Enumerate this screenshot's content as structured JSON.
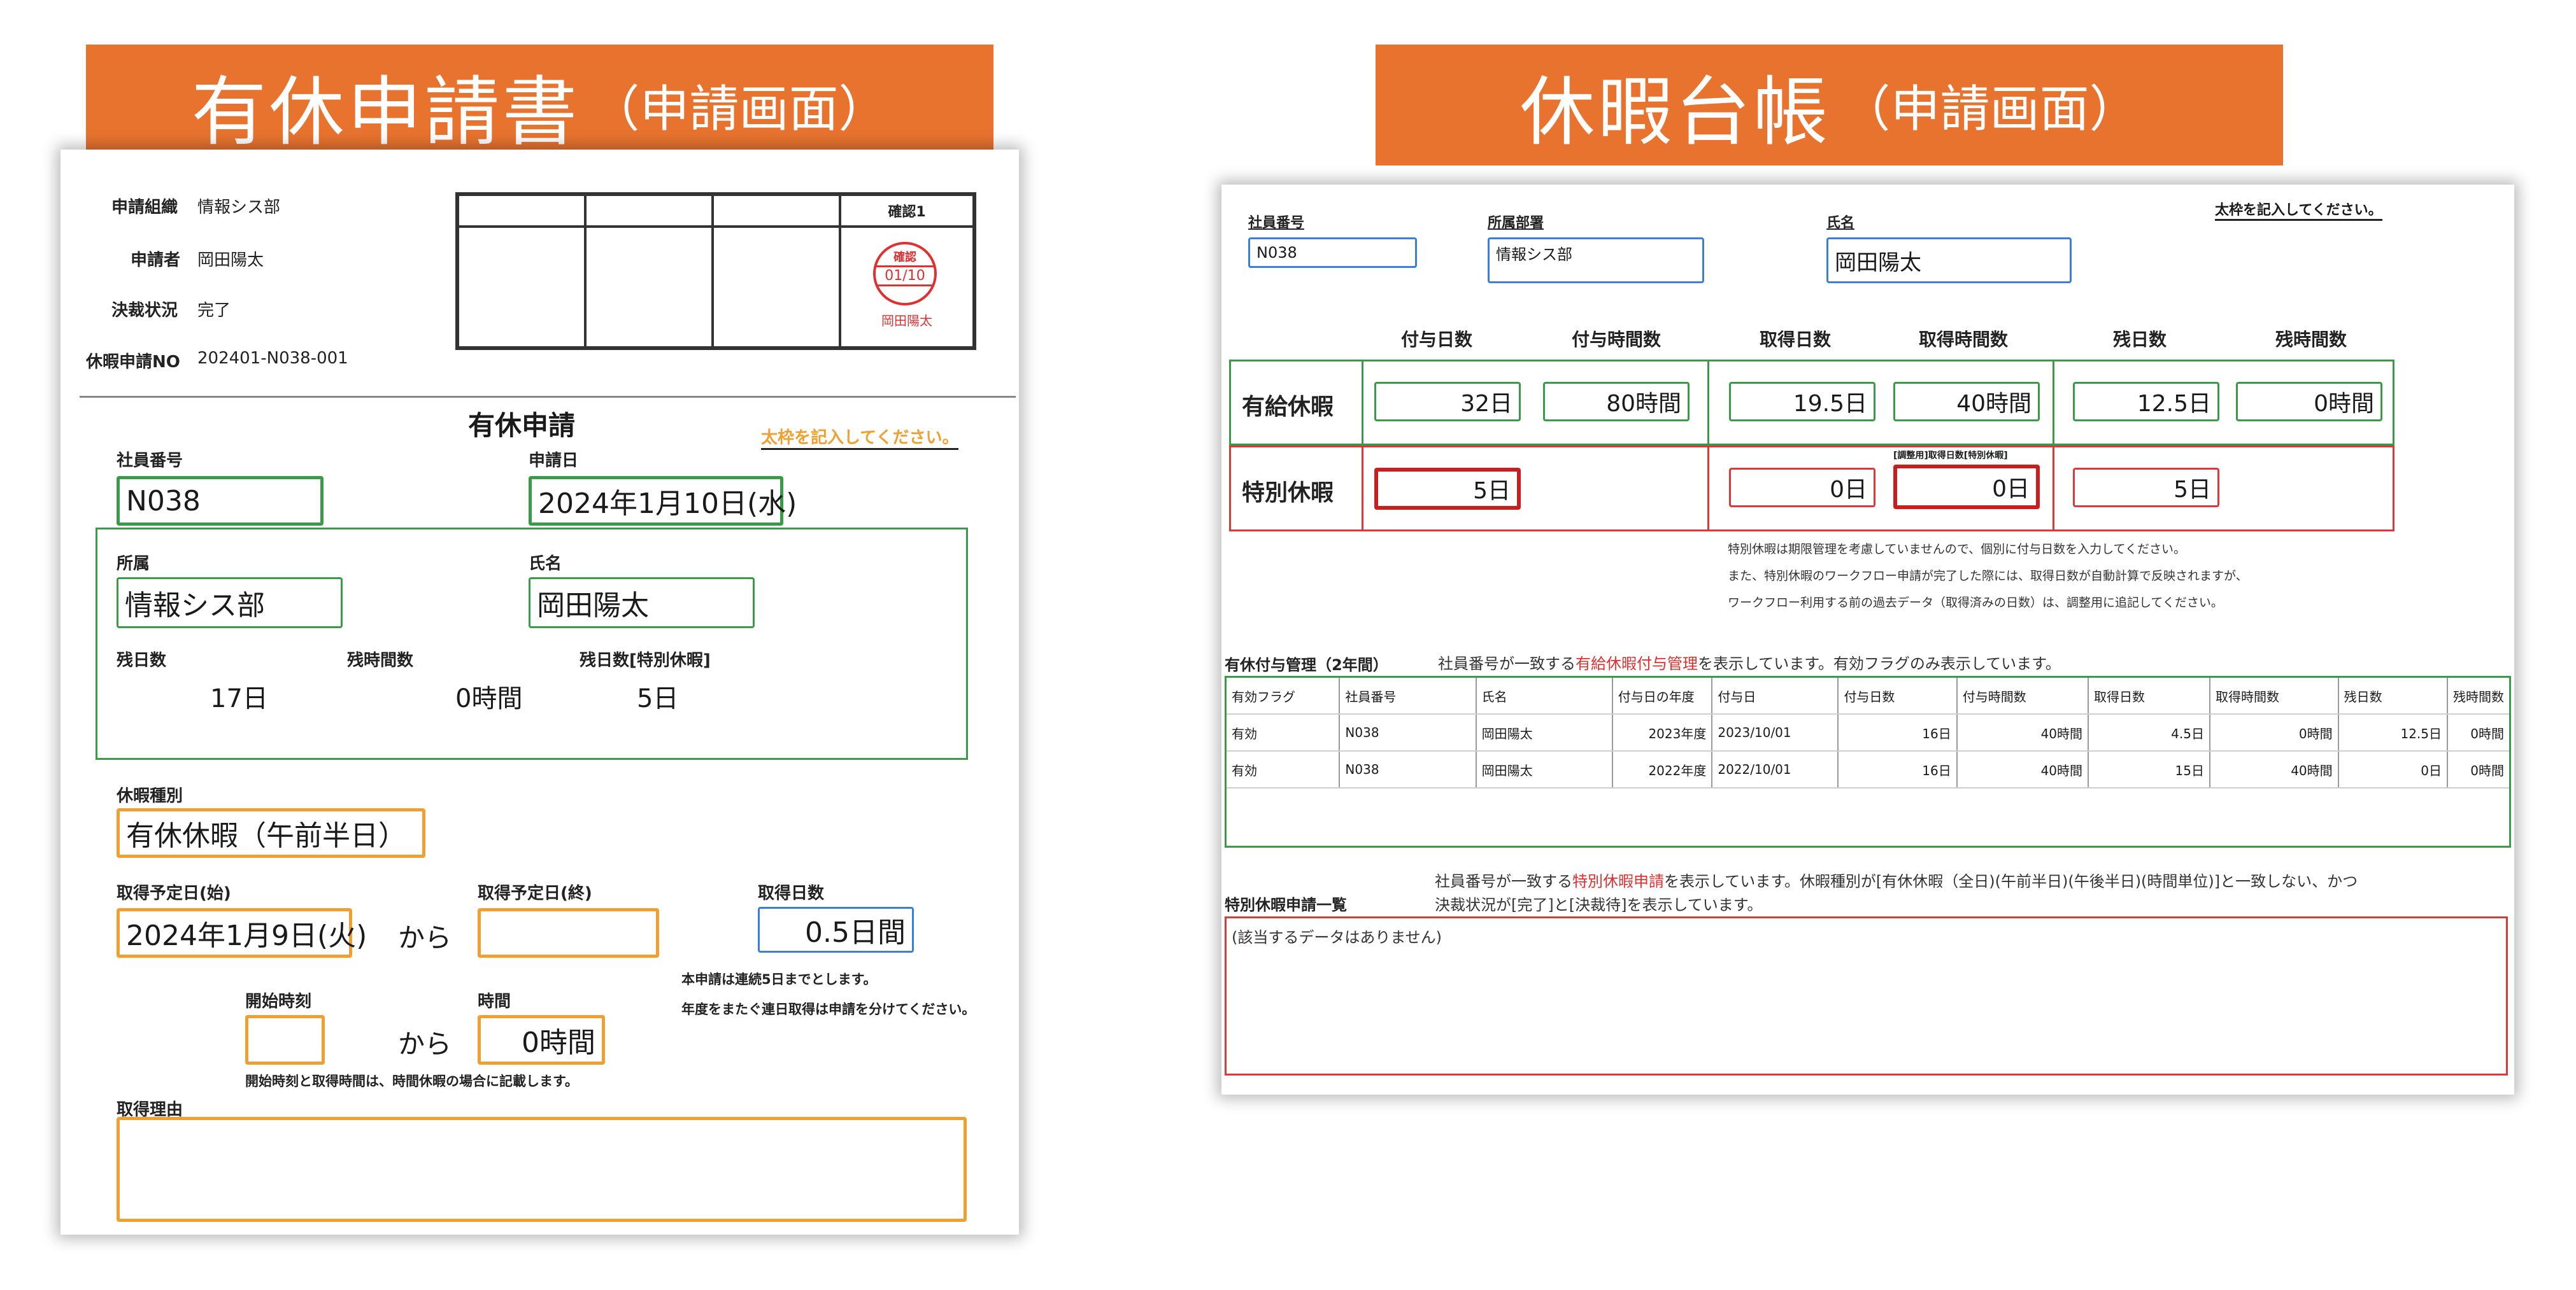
{
  "left": {
    "banner": {
      "main": "有休申請書",
      "sub": "（申請画面）"
    },
    "header": {
      "org_label": "申請組織",
      "org_value": "情報シス部",
      "applicant_label": "申請者",
      "applicant_value": "岡田陽太",
      "status_label": "決裁状況",
      "status_value": "完了",
      "no_label": "休暇申請NO",
      "no_value": "202401-N038-001"
    },
    "stamp": {
      "column_title": "確認1",
      "seal_top": "確認",
      "seal_date": "01/10",
      "seal_name": "岡田陽太"
    },
    "form_title": "有休申請",
    "note": "太枠を記入してください。",
    "employee_no_label": "社員番号",
    "employee_no": "N038",
    "apply_date_label": "申請日",
    "apply_date": "2024年1月10日(水)",
    "dept_label": "所属",
    "dept": "情報シス部",
    "name_label": "氏名",
    "name": "岡田陽太",
    "remaining_days_label": "残日数",
    "remaining_days": "17日",
    "remaining_hours_label": "残時間数",
    "remaining_hours": "0時間",
    "remaining_special_label": "残日数[特別休暇]",
    "remaining_special": "5日",
    "leave_type_label": "休暇種別",
    "leave_type": "有休休暇（午前半日）",
    "start_date_label": "取得予定日(始)",
    "start_date": "2024年1月9日(火)",
    "from1": "から",
    "end_date_label": "取得予定日(終)",
    "end_date": "",
    "days_label": "取得日数",
    "days": "0.5日間",
    "rule1": "本申請は連続5日までとします。",
    "rule2": "年度をまたぐ連日取得は申請を分けてください。",
    "start_time_label": "開始時刻",
    "start_time": "",
    "from2": "から",
    "hours_label": "時間",
    "hours": "0時間",
    "time_note": "開始時刻と取得時間は、時間休暇の場合に記載します。",
    "reason_label": "取得理由",
    "reason": ""
  },
  "right": {
    "banner": {
      "main": "休暇台帳",
      "sub": "（申請画面）"
    },
    "note": "太枠を記入してください。",
    "employee_no_label": "社員番号",
    "employee_no": "N038",
    "dept_label": "所属部署",
    "dept": "情報シス部",
    "name_label": "氏名",
    "name": "岡田陽太",
    "col_headers": [
      "付与日数",
      "付与時間数",
      "取得日数",
      "取得時間数",
      "残日数",
      "残時間数"
    ],
    "paid": {
      "label": "有給休暇",
      "grant_days": "32日",
      "grant_hours": "80時間",
      "used_days": "19.5日",
      "used_hours": "40時間",
      "remain_days": "12.5日",
      "remain_hours": "0時間"
    },
    "special": {
      "label": "特別休暇",
      "grant_days": "5日",
      "used_days": "0日",
      "adjust_label": "[調整用]取得日数[特別休暇]",
      "adjust_days": "0日",
      "remain_days": "5日"
    },
    "notes": [
      "特別休暇は期限管理を考慮していませんので、個別に付与日数を入力してください。",
      "また、特別休暇のワークフロー申請が完了した際には、取得日数が自動計算で反映されますが、",
      "ワークフロー利用する前の過去データ（取得済みの日数）は、調整用に追記してください。"
    ],
    "grant_section": {
      "title": "有休付与管理（2年間）",
      "desc_before": "社員番号が一致する",
      "desc_link": "有給休暇付与管理",
      "desc_after": "を表示しています。有効フラグのみ表示しています。"
    },
    "grant_table": {
      "headers": [
        "有効フラグ",
        "社員番号",
        "氏名",
        "付与日の年度",
        "付与日",
        "付与日数",
        "付与時間数",
        "取得日数",
        "取得時間数",
        "残日数",
        "残時間数"
      ],
      "rows": [
        [
          "有効",
          "N038",
          "岡田陽太",
          "2023年度",
          "2023/10/01",
          "16日",
          "40時間",
          "4.5日",
          "0時間",
          "12.5日",
          "0時間"
        ],
        [
          "有効",
          "N038",
          "岡田陽太",
          "2022年度",
          "2022/10/01",
          "16日",
          "40時間",
          "15日",
          "40時間",
          "0日",
          "0時間"
        ]
      ]
    },
    "special_section": {
      "title": "特別休暇申請一覧",
      "desc1_before": "社員番号が一致する",
      "desc1_link": "特別休暇申請",
      "desc1_after": "を表示しています。休暇種別が[有休休暇（全日)(午前半日)(午後半日)(時間単位)]と一致しない、かつ",
      "desc2": "決裁状況が[完了]と[決裁待]を表示しています。",
      "empty": "(該当するデータはありません)"
    }
  },
  "colors": {
    "banner": "#e8732f",
    "green": "#3a9a48",
    "orange": "#f0a030",
    "red": "#d83a3a",
    "blue": "#3a7fd5"
  }
}
